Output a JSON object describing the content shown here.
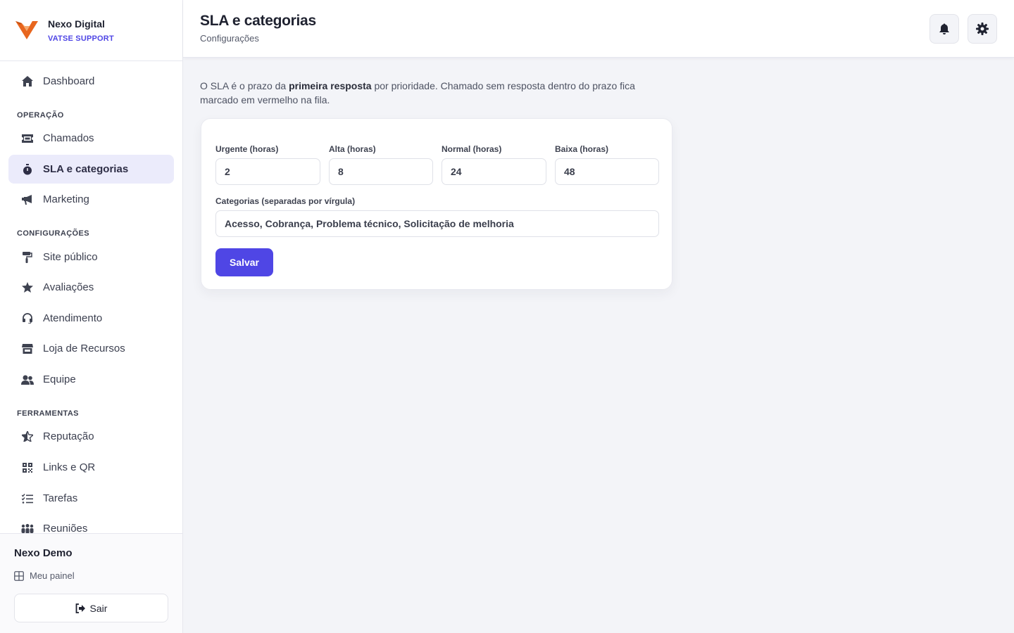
{
  "brand": {
    "name": "Nexo Digital",
    "subtitle": "VATSE SUPPORT",
    "accent_color": "#e8661e"
  },
  "sidebar": {
    "items": [
      {
        "label": "Dashboard",
        "icon": "home-icon"
      },
      {
        "label": "Chamados",
        "icon": "ticket-icon"
      },
      {
        "label": "SLA e categorias",
        "icon": "stopwatch-icon",
        "active": true
      },
      {
        "label": "Marketing",
        "icon": "megaphone-icon"
      },
      {
        "label": "Site público",
        "icon": "paint-roller-icon"
      },
      {
        "label": "Avaliações",
        "icon": "star-icon"
      },
      {
        "label": "Atendimento",
        "icon": "headset-icon"
      },
      {
        "label": "Loja de Recursos",
        "icon": "store-icon"
      },
      {
        "label": "Equipe",
        "icon": "users-icon"
      },
      {
        "label": "Reputação",
        "icon": "star-half-icon"
      },
      {
        "label": "Links e QR",
        "icon": "qrcode-icon"
      },
      {
        "label": "Tarefas",
        "icon": "tasks-icon"
      },
      {
        "label": "Reuniões",
        "icon": "people-group-icon"
      }
    ],
    "sections": [
      "OPERAÇÃO",
      "CONFIGURAÇÕES",
      "FERRAMENTAS"
    ],
    "footer": {
      "user_name": "Nexo Demo",
      "panel_link": "Meu painel",
      "logout_label": "Sair"
    }
  },
  "header": {
    "title": "SLA e categorias",
    "subtitle": "Configurações",
    "notification_icon": "bell-icon",
    "settings_icon": "gear-icon"
  },
  "main": {
    "intro_before": "O SLA é o prazo da ",
    "intro_bold": "primeira resposta",
    "intro_after": " por prioridade. Chamado sem resposta dentro do prazo fica marcado em vermelho na fila.",
    "form": {
      "fields": [
        {
          "label": "Urgente (horas)",
          "value": "2"
        },
        {
          "label": "Alta (horas)",
          "value": "8"
        },
        {
          "label": "Normal (horas)",
          "value": "24"
        },
        {
          "label": "Baixa (horas)",
          "value": "48"
        }
      ],
      "categories_label": "Categorias (separadas por vírgula)",
      "categories_value": "Acesso, Cobrança, Problema técnico, Solicitação de melhoria",
      "save_label": "Salvar"
    }
  },
  "colors": {
    "primary": "#4f46e5",
    "active_nav_bg": "#ebebfb",
    "page_bg": "#f3f4f8"
  }
}
